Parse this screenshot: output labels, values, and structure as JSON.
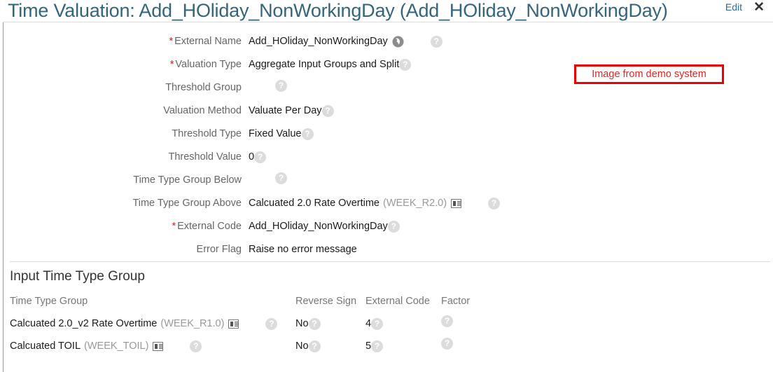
{
  "header": {
    "title": "Time Valuation: Add_HOliday_NonWorkingDay (Add_HOliday_NonWorkingDay)",
    "edit_label": "Edit",
    "close_label": "✕"
  },
  "annotation": {
    "text": "Image from demo system",
    "border_color": "#ee0000",
    "text_color": "#ee2222"
  },
  "form": {
    "rows": [
      {
        "label": "External Name",
        "required": true,
        "value": "Add_HOliday_NonWorkingDay",
        "globe": true,
        "help": true,
        "help_gap": true
      },
      {
        "label": "Valuation Type",
        "required": true,
        "value": "Aggregate Input Groups and Split",
        "globe": false,
        "help": true,
        "help_gap": false
      },
      {
        "label": "Threshold Group",
        "required": false,
        "value": "",
        "globe": false,
        "help": true,
        "help_gap": true
      },
      {
        "label": "Valuation Method",
        "required": false,
        "value": "Valuate Per Day",
        "globe": false,
        "help": true,
        "help_gap": false
      },
      {
        "label": "Threshold Type",
        "required": false,
        "value": "Fixed Value",
        "globe": false,
        "help": true,
        "help_gap": false
      },
      {
        "label": "Threshold Value",
        "required": false,
        "value": "0",
        "globe": false,
        "help": true,
        "help_gap": false
      },
      {
        "label": "Time Type Group Below",
        "required": false,
        "value": "",
        "globe": false,
        "help": true,
        "help_gap": true
      },
      {
        "label": "Time Type Group Above",
        "required": false,
        "value": "Calcuated 2.0 Rate Overtime",
        "code": "(WEEK_R2.0)",
        "card": true,
        "globe": false,
        "help": true,
        "help_gap": true
      },
      {
        "label": "External Code",
        "required": true,
        "value": "Add_HOliday_NonWorkingDay",
        "globe": false,
        "help": true,
        "help_gap": false
      },
      {
        "label": "Error Flag",
        "required": false,
        "value": "Raise no error message",
        "globe": false,
        "help": false,
        "help_gap": false
      }
    ]
  },
  "section": {
    "title": "Input Time Type Group"
  },
  "table": {
    "columns": [
      "Time Type Group",
      "Reverse Sign",
      "External Code",
      "Factor"
    ],
    "rows": [
      {
        "name": "Calcuated 2.0_v2 Rate Overtime",
        "code": "(WEEK_R1.0)",
        "reverse_sign": "No",
        "external_code": "4",
        "factor": ""
      },
      {
        "name": "Calcuated TOIL",
        "code": "(WEEK_TOIL)",
        "reverse_sign": "No",
        "external_code": "5",
        "factor": ""
      }
    ]
  },
  "icons": {
    "help": "?",
    "globe": "globe-icon",
    "card": "record-card-icon"
  }
}
